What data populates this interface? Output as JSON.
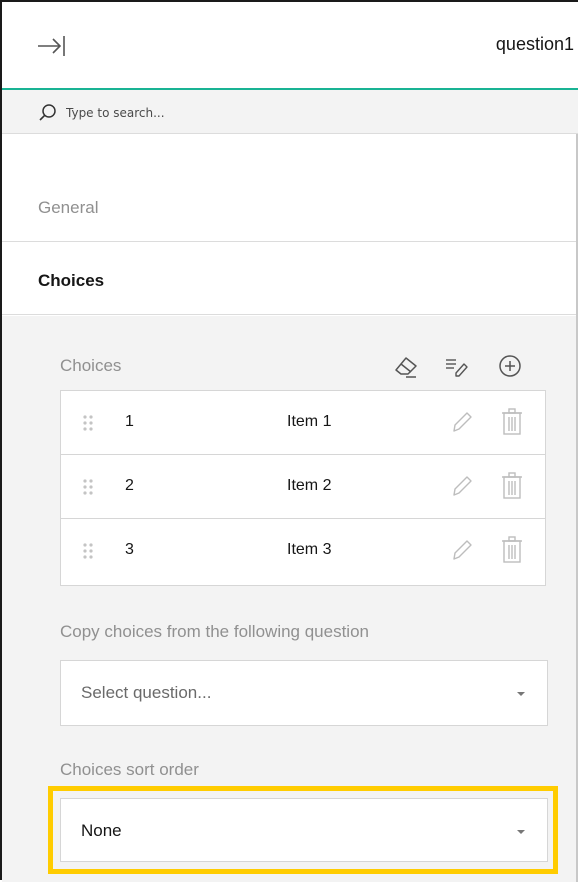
{
  "header": {
    "title": "question1"
  },
  "search": {
    "placeholder": "Type to search..."
  },
  "sections": {
    "general": "General",
    "choices": "Choices"
  },
  "choices_editor": {
    "label": "Choices",
    "items": [
      {
        "value": "1",
        "text": "Item 1"
      },
      {
        "value": "2",
        "text": "Item 2"
      },
      {
        "value": "3",
        "text": "Item 3"
      }
    ]
  },
  "copy_choices": {
    "label": "Copy choices from the following question",
    "placeholder": "Select question..."
  },
  "sort_order": {
    "label": "Choices sort order",
    "value": "None"
  },
  "colors": {
    "accent": "#19b394",
    "highlight": "#ffcc00",
    "muted_text": "#909090",
    "panel_bg": "#f3f3f3"
  },
  "icons": {
    "collapse": "arrow-to-right-icon",
    "search": "search-icon",
    "clear": "eraser-icon",
    "edit_all": "list-edit-icon",
    "add": "plus-circle-icon",
    "drag": "drag-handle-icon",
    "edit": "pencil-icon",
    "delete": "trash-icon",
    "dropdown": "chevron-down-icon"
  }
}
